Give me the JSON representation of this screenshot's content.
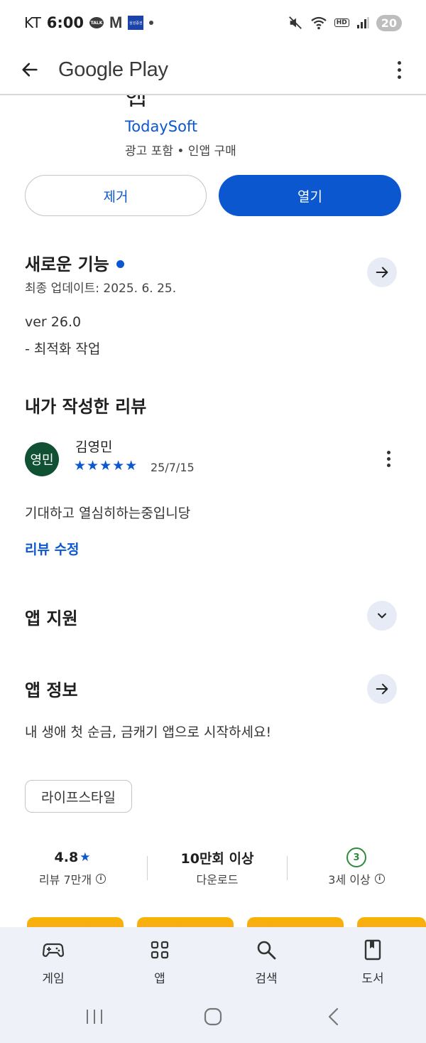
{
  "status_bar": {
    "carrier": "KT",
    "time": "6:00",
    "talk_badge": "TALK",
    "m_badge": "M",
    "bank_badge": "삼성증권",
    "hd_badge": "HD",
    "battery": "20"
  },
  "app_bar": {
    "title": "Google Play"
  },
  "app_header": {
    "clipped_title": "앱",
    "developer": "TodaySoft",
    "meta": "광고 포함 • 인앱 구매"
  },
  "actions": {
    "remove_label": "제거",
    "open_label": "열기"
  },
  "whats_new": {
    "title": "새로운 기능",
    "last_updated": "최종 업데이트: 2025. 6. 25.",
    "version": "ver 26.0",
    "notes": "- 최적화 작업"
  },
  "my_review": {
    "title": "내가 작성한 리뷰",
    "avatar_text": "영민",
    "reviewer_name": "김영민",
    "stars": "★★★★★",
    "rating": 5,
    "date": "25/7/15",
    "text": "기대하고 열심히하는중입니당",
    "edit_label": "리뷰 수정"
  },
  "app_support": {
    "title": "앱 지원"
  },
  "app_info": {
    "title": "앱 정보",
    "description": "내 생애 첫 순금, 금캐기 앱으로 시작하세요!",
    "category_chip": "라이프스타일"
  },
  "stats": {
    "rating_value": "4.8",
    "rating_star": "★",
    "rating_label": "리뷰 7만개",
    "downloads_value": "10만회 이상",
    "downloads_label": "다운로드",
    "age_badge": "3",
    "age_label": "3세 이상",
    "info_glyph": "i"
  },
  "bottom_nav": {
    "items": [
      {
        "label": "게임",
        "icon": "gamepad-icon"
      },
      {
        "label": "앱",
        "icon": "apps-grid-icon"
      },
      {
        "label": "검색",
        "icon": "search-icon"
      },
      {
        "label": "도서",
        "icon": "book-icon"
      }
    ]
  },
  "colors": {
    "accent": "#0b57d0",
    "avatar_bg": "#0f5132",
    "age_green": "#2e8b3d",
    "nav_bg": "#eef2f8"
  }
}
